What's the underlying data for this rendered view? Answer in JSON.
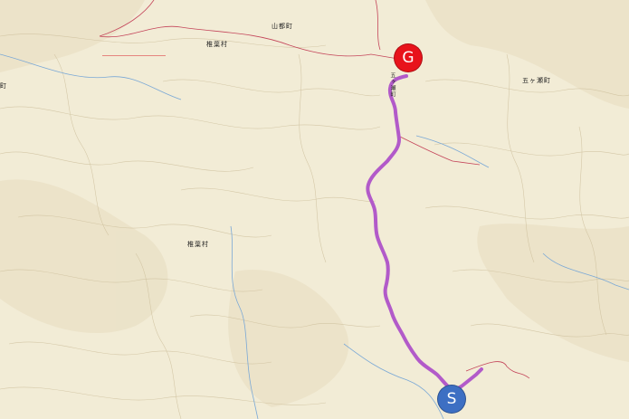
{
  "map": {
    "place_labels": {
      "yamato": "山都町",
      "shiiba_north": "椎葉村",
      "shiiba_center": "椎葉村",
      "gokase_west": "五ヶ瀬町",
      "gokase_east": "五ヶ瀬町",
      "left_edge": "町"
    },
    "start_marker": {
      "label": "S",
      "color": "#3d6fc3"
    },
    "goal_marker": {
      "label": "G",
      "color": "#e8131b"
    },
    "route_color": "#b25ac9"
  }
}
